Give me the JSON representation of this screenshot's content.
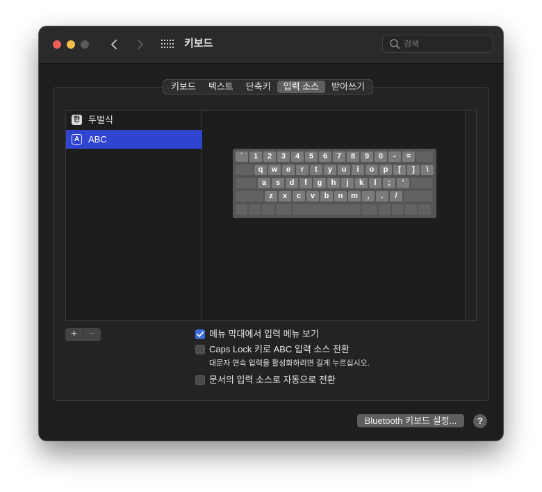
{
  "window": {
    "title": "키보드"
  },
  "search": {
    "placeholder": "검색"
  },
  "tabs": [
    {
      "label": "키보드",
      "active": false
    },
    {
      "label": "텍스트",
      "active": false
    },
    {
      "label": "단축키",
      "active": false
    },
    {
      "label": "입력 소스",
      "active": true
    },
    {
      "label": "받아쓰기",
      "active": false
    }
  ],
  "sources": [
    {
      "icon_text": "한",
      "label": "두벌식",
      "selected": false
    },
    {
      "icon_text": "A",
      "label": "ABC",
      "selected": true
    }
  ],
  "keyboard": {
    "row1": [
      "`",
      "1",
      "2",
      "3",
      "4",
      "5",
      "6",
      "7",
      "8",
      "9",
      "0",
      "-",
      "="
    ],
    "row2": [
      "q",
      "w",
      "e",
      "r",
      "t",
      "y",
      "u",
      "i",
      "o",
      "p",
      "[",
      "]",
      "\\"
    ],
    "row3": [
      "a",
      "s",
      "d",
      "f",
      "g",
      "h",
      "j",
      "k",
      "l",
      ";",
      "'"
    ],
    "row4": [
      "z",
      "x",
      "c",
      "v",
      "b",
      "n",
      "m",
      ",",
      ".",
      "/"
    ]
  },
  "list_controls": {
    "add": "+",
    "remove": "−"
  },
  "options": {
    "show_menu": {
      "label": "메뉴 막대에서 입력 메뉴 보기",
      "checked": true
    },
    "caps_lock": {
      "label": "Caps Lock 키로 ABC 입력 소스 전환",
      "checked": false,
      "hint": "대문자 연속 입력을 활성화하려면 길게 누르십시오."
    },
    "auto_switch": {
      "label": "문서의 입력 소스로 자동으로 전환",
      "checked": false
    }
  },
  "footer": {
    "bluetooth_button": "Bluetooth 키보드 설정...",
    "help": "?"
  },
  "colors": {
    "accent": "#2f44cf",
    "checkbox": "#3a6cdc"
  }
}
